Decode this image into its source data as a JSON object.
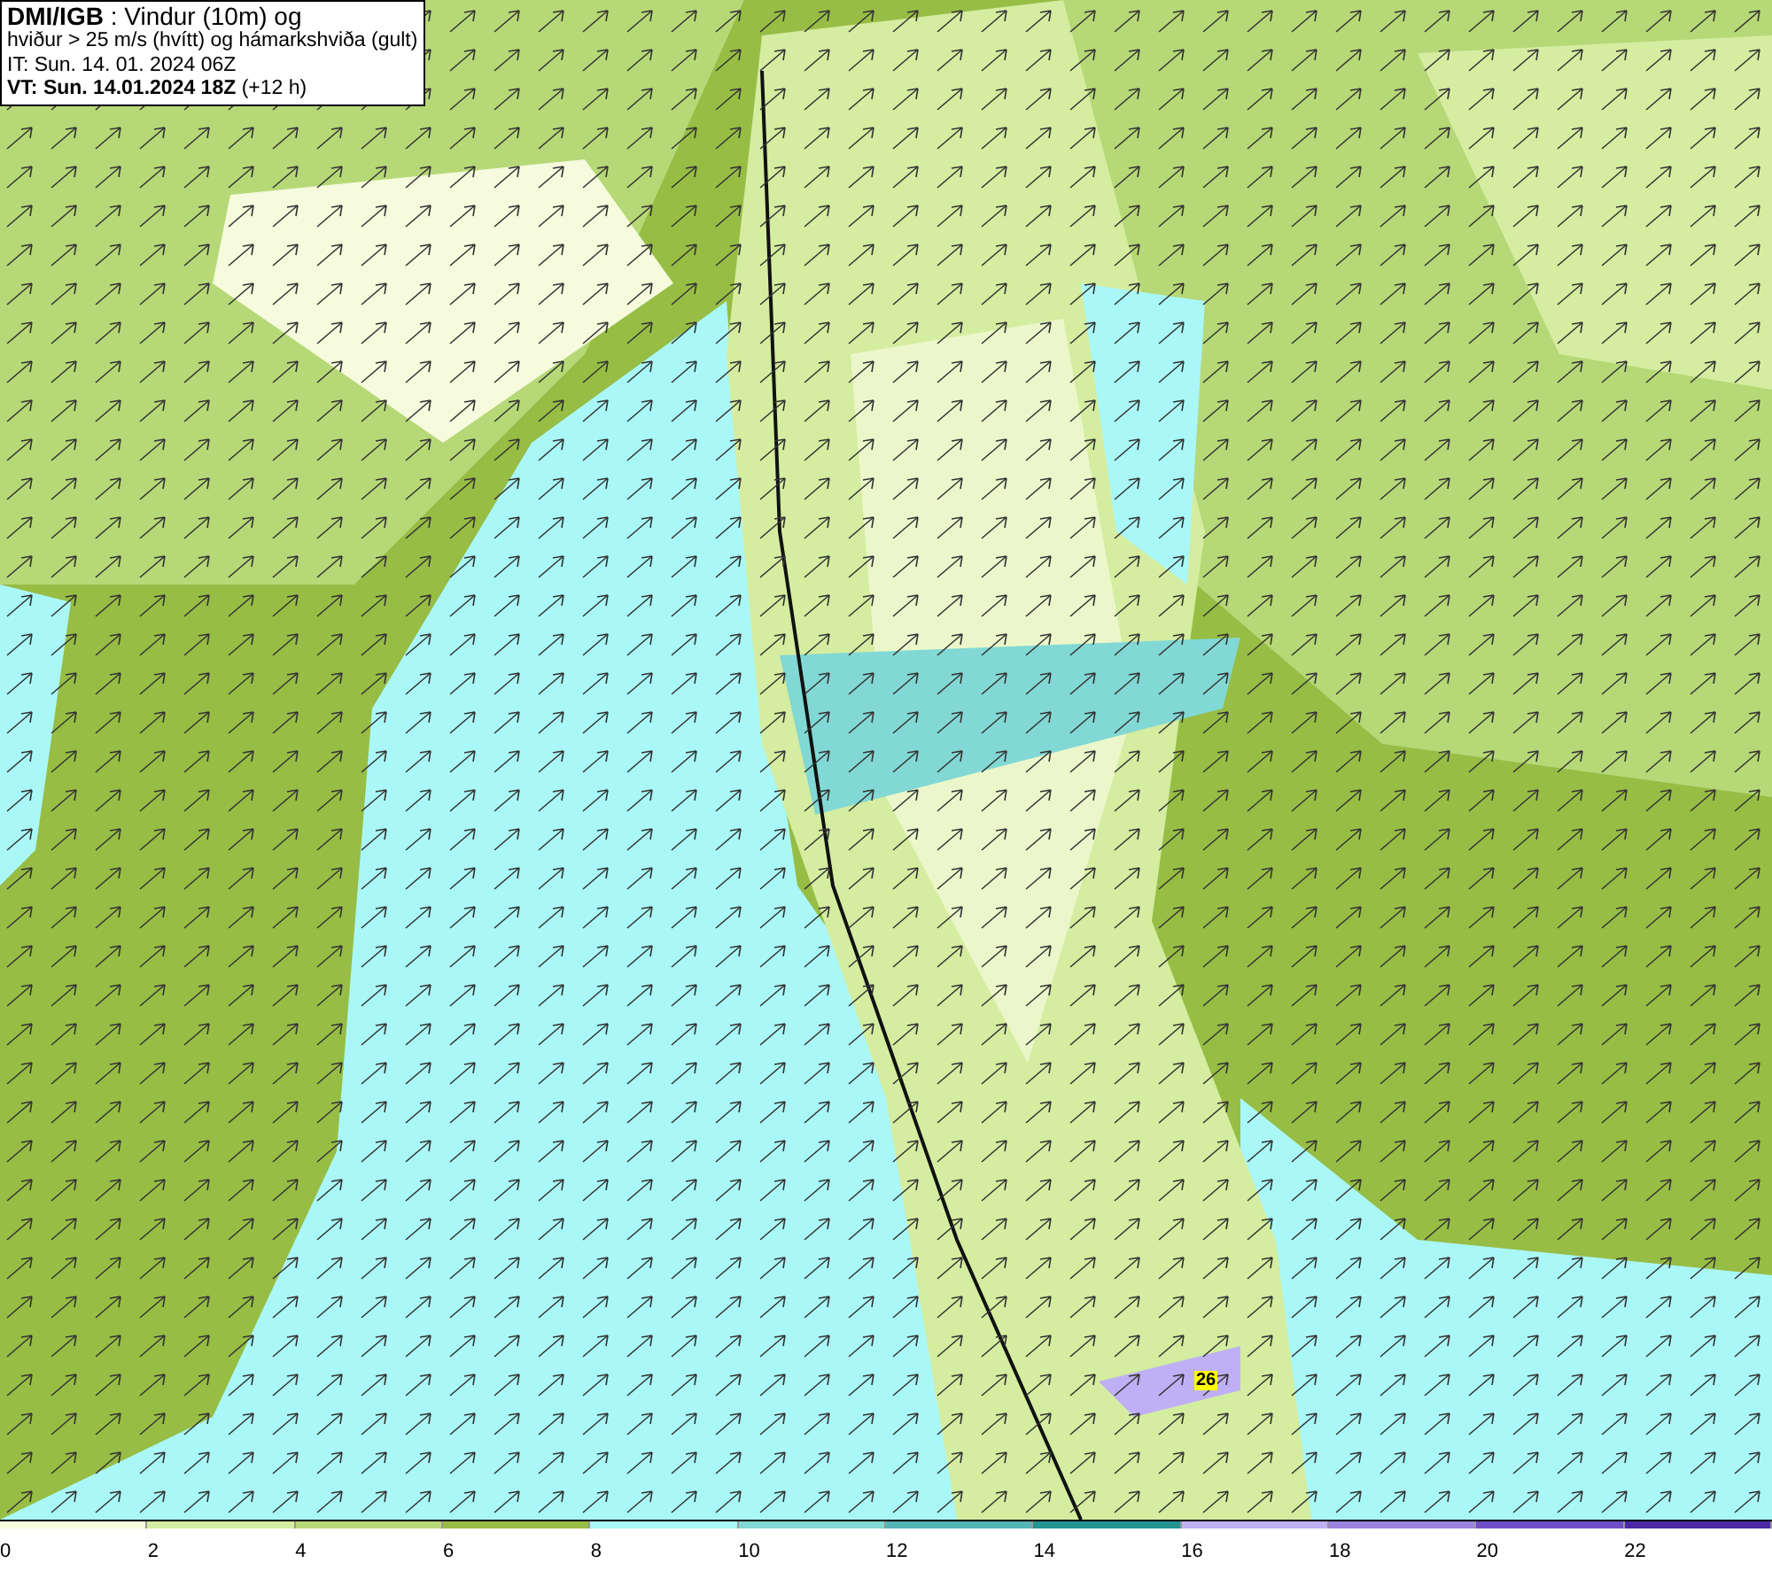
{
  "header": {
    "lines": [
      "**DMI/IGB** : Vindur (10m) og",
      "hviður > 25 m/s (hvítt) og hámarkshviða (gult)",
      "IT: Sun. 14. 01. 2024 06Z",
      "**VT: Sun. 14.01.2024 18Z** (+12 h)"
    ]
  },
  "map": {
    "gust_marker": "26"
  },
  "legend": {
    "segments": [
      {
        "color": "#f5fbdc"
      },
      {
        "color": "#d4eda0"
      },
      {
        "color": "#b6d877"
      },
      {
        "color": "#97bd45"
      },
      {
        "color": "#aaf7f7"
      },
      {
        "color": "#82d8d4"
      },
      {
        "color": "#55b4b4"
      },
      {
        "color": "#249492"
      },
      {
        "color": "#bfb0f5"
      },
      {
        "color": "#9b84e0"
      },
      {
        "color": "#6f4fc8"
      },
      {
        "color": "#4a28a6"
      }
    ],
    "labels": [
      "0",
      "2",
      "4",
      "6",
      "8",
      "10",
      "12",
      "14",
      "16",
      "18",
      "20",
      "22"
    ]
  }
}
